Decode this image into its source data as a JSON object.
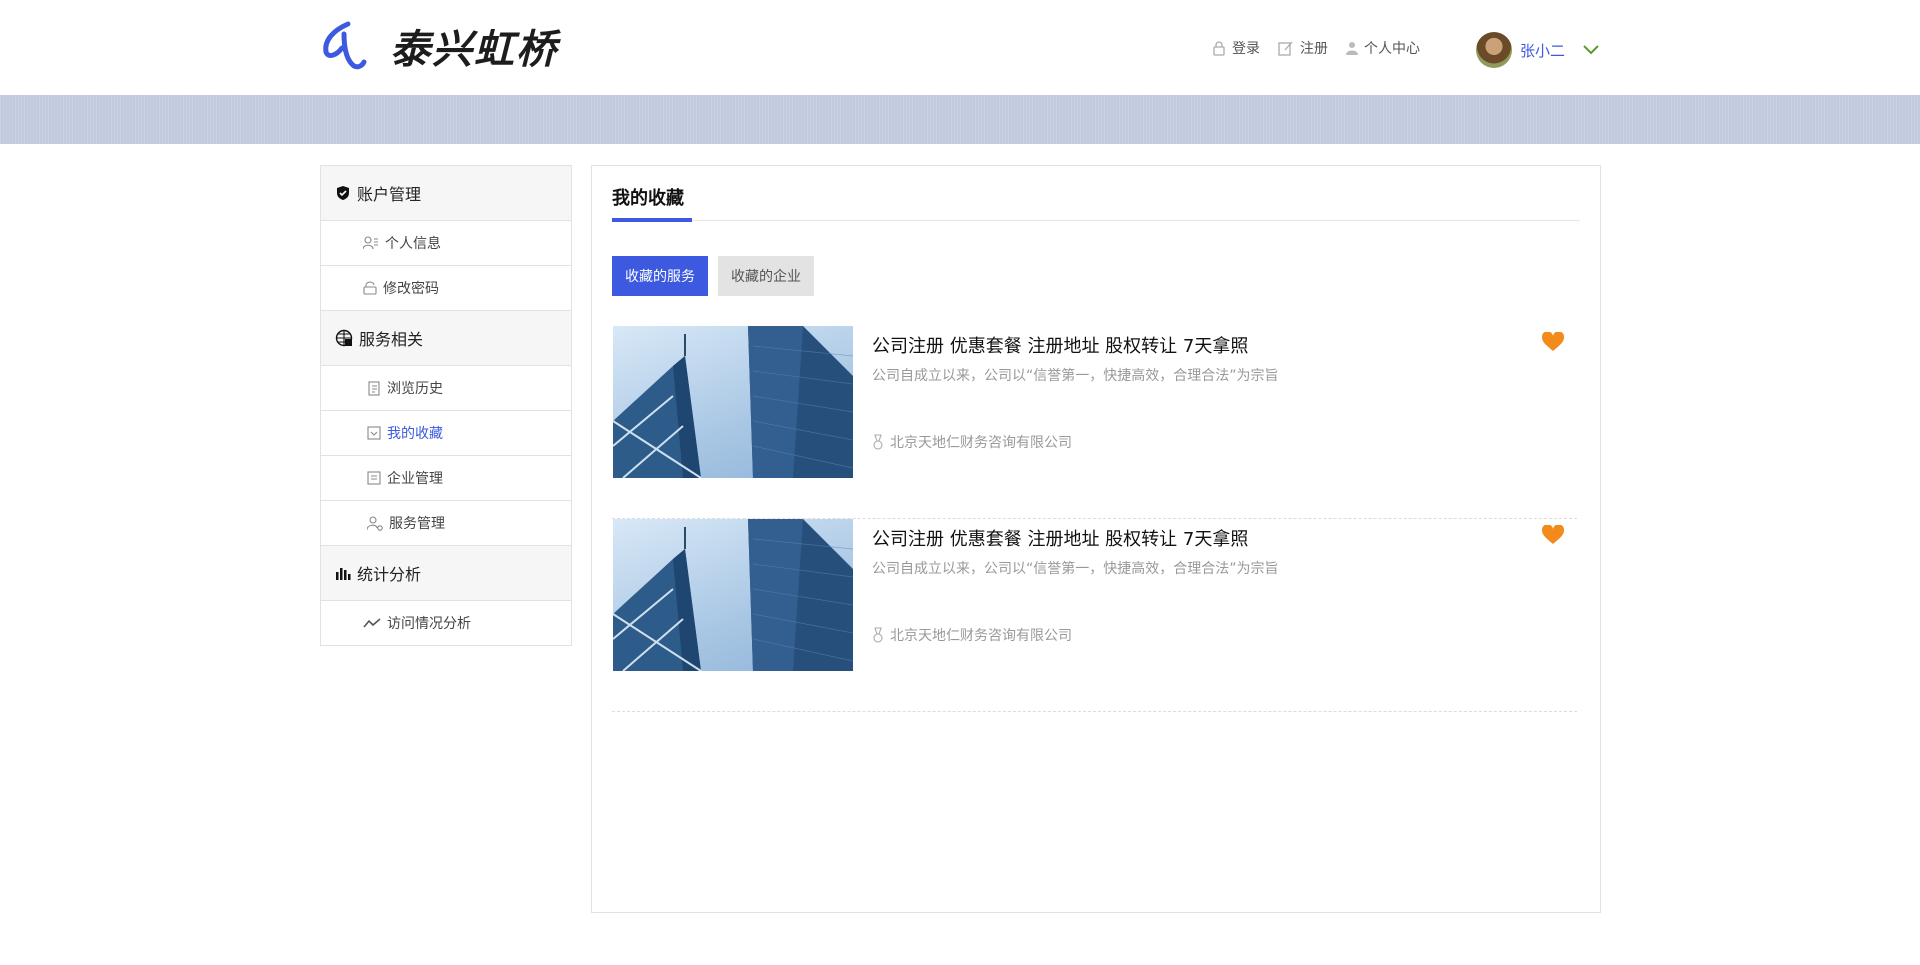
{
  "header": {
    "logo_text": "泰兴虹桥",
    "nav": {
      "login": "登录",
      "register": "注册",
      "personal_center": "个人中心"
    },
    "user": {
      "name": "张小二"
    }
  },
  "sidebar": {
    "groups": [
      {
        "label": "账户管理",
        "icon": "shield-check-icon",
        "items": [
          {
            "label": "个人信息",
            "icon": "user-list-icon"
          },
          {
            "label": "修改密码",
            "icon": "lock-icon"
          }
        ]
      },
      {
        "label": "服务相关",
        "icon": "globe-grid-icon",
        "items": [
          {
            "label": "浏览历史",
            "icon": "document-icon"
          },
          {
            "label": "我的收藏",
            "icon": "favorite-box-icon",
            "active": true
          },
          {
            "label": "企业管理",
            "icon": "list-doc-icon"
          },
          {
            "label": "服务管理",
            "icon": "user-settings-icon"
          }
        ]
      },
      {
        "label": "统计分析",
        "icon": "bar-chart-icon",
        "items": [
          {
            "label": "访问情况分析",
            "icon": "trend-line-icon"
          }
        ]
      }
    ]
  },
  "main": {
    "title": "我的收藏",
    "tabs": [
      {
        "label": "收藏的服务",
        "active": true
      },
      {
        "label": "收藏的企业",
        "active": false
      }
    ],
    "cards": [
      {
        "title": "公司注册  优惠套餐  注册地址  股权转让  7天拿照",
        "description": "公司自成立以来，公司以“信誉第一，快捷高效，合理合法”为宗旨",
        "company": "北京天地仁财务咨询有限公司"
      },
      {
        "title": "公司注册  优惠套餐  注册地址  股权转让  7天拿照",
        "description": "公司自成立以来，公司以“信誉第一，快捷高效，合理合法”为宗旨",
        "company": "北京天地仁财务咨询有限公司"
      }
    ]
  },
  "colors": {
    "accent": "#3c59e0",
    "heart": "#f28a1c",
    "banner": "#c1cade"
  }
}
